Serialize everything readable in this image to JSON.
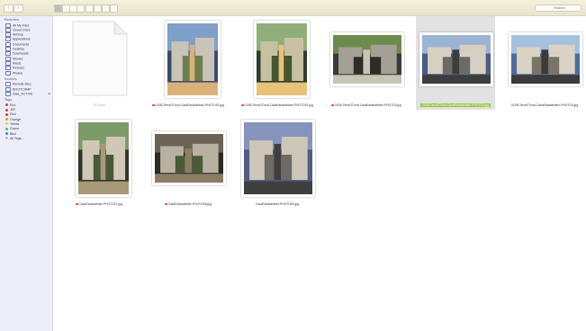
{
  "search": {
    "placeholder": "Search"
  },
  "sidebar": {
    "favorites_header": "Favorites",
    "favorites": [
      {
        "label": "All My Files",
        "icon": "all-files-icon"
      },
      {
        "label": "iCloud Drive",
        "icon": "cloud-icon"
      },
      {
        "label": "AirDrop",
        "icon": "airdrop-icon"
      },
      {
        "label": "Applications",
        "icon": "applications-icon"
      },
      {
        "label": "Documents",
        "icon": "documents-icon"
      },
      {
        "label": "Desktop",
        "icon": "desktop-icon"
      },
      {
        "label": "Downloads",
        "icon": "downloads-icon"
      },
      {
        "label": "Movies",
        "icon": "movies-icon"
      },
      {
        "label": "Music",
        "icon": "music-icon"
      },
      {
        "label": "Pictures",
        "icon": "pictures-icon"
      },
      {
        "label": "Photos",
        "icon": "photos-icon"
      }
    ],
    "devices_header": "Devices",
    "devices": [
      {
        "label": "Remote Disc",
        "icon": "disc-icon"
      },
      {
        "label": "BOOTCAMP",
        "icon": "drive-icon"
      },
      {
        "label": "Sata_ACTIVE",
        "icon": "drive-icon"
      }
    ],
    "tags_header": "Tags",
    "tags": [
      {
        "label": "Eco",
        "color": "#e23a3a"
      },
      {
        "label": "JKF",
        "color": "#e23a3a"
      },
      {
        "label": "Red",
        "color": "#e23a3a"
      },
      {
        "label": "Orange",
        "color": "#f39a2b"
      },
      {
        "label": "Yellow",
        "color": "#f2d33a"
      },
      {
        "label": "Green",
        "color": "#5bbf3e"
      },
      {
        "label": "Blue",
        "color": "#3a82e2"
      },
      {
        "label": "All Tags...",
        "color": "#bdbdbd"
      }
    ]
  },
  "files": [
    {
      "name": "DS Store",
      "tagged": false,
      "selected": false,
      "kind": "doc"
    },
    {
      "name": "01SB-TerraGTurra-CasaParadaHider-PHOTOS1.jpg",
      "tagged": true,
      "selected": false,
      "kind": "photo"
    },
    {
      "name": "01SB-TerraGTurra-CasaParadaHider-PHOTOS1.jpg",
      "tagged": true,
      "selected": false,
      "kind": "photo"
    },
    {
      "name": "01SB-TerraGTurra-CasaParadaHider-PHOTO3.jpg",
      "tagged": true,
      "selected": false,
      "kind": "photo"
    },
    {
      "name": "01SB-TerraGTurra-CasaParadaHider-PHOTO4.jpg",
      "tagged": false,
      "selected": true,
      "kind": "photo"
    },
    {
      "name": "01SB-TerraGTurra-CasaParadaHider-PHOTO5.jpg",
      "tagged": false,
      "selected": false,
      "kind": "photo"
    },
    {
      "name": "CasaParadaHider-PHOTOS7.jpg",
      "tagged": true,
      "selected": false,
      "kind": "photo"
    },
    {
      "name": "CasaParadaHider-PHOTOS8.jpg",
      "tagged": true,
      "selected": false,
      "kind": "photo"
    },
    {
      "name": "CasaParadaHider-PHOTOS9.jpg",
      "tagged": false,
      "selected": false,
      "kind": "photo"
    }
  ],
  "colors": {
    "selection_label": "#93c93e",
    "tag_red": "#e23a3a",
    "sidebar_bg": "#eeeefb"
  }
}
